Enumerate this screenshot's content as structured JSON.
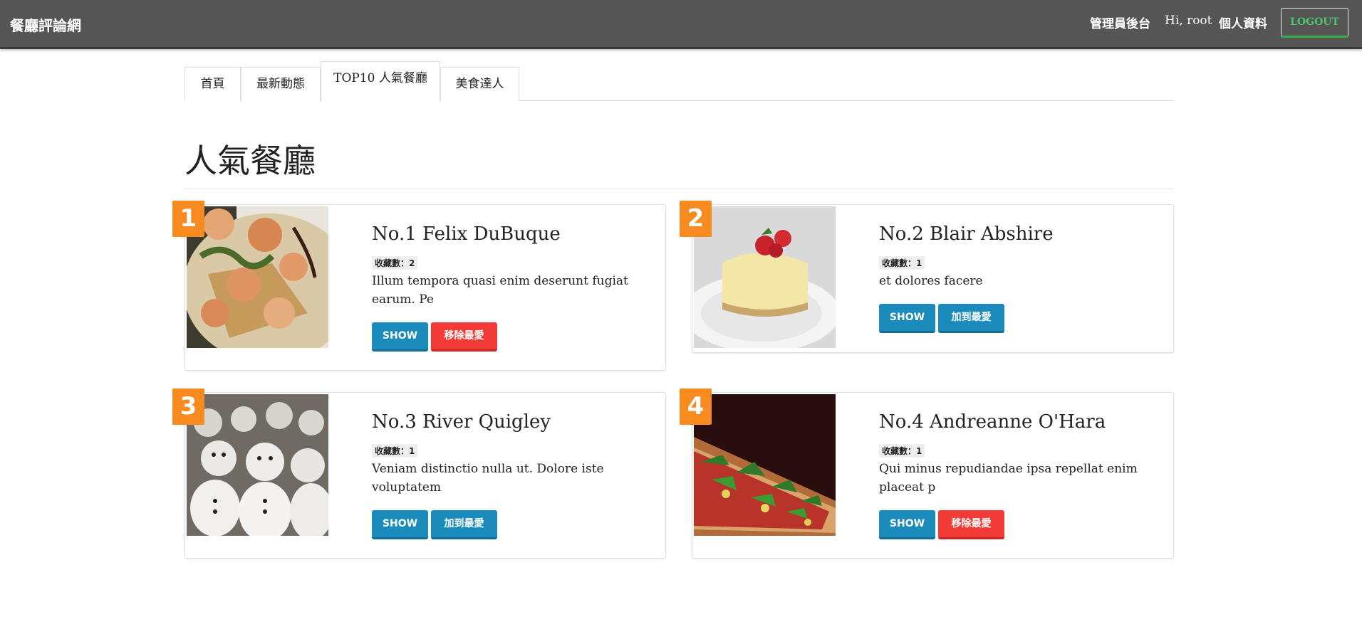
{
  "navbar": {
    "brand": "餐廳評論網",
    "admin_link": "管理員後台",
    "user_greeting": "Hi, root",
    "profile_link": "個人資料",
    "logout_label": "LOGOUT",
    "logout_color": "#49c76a"
  },
  "tabs": [
    {
      "label": "首頁",
      "active": false
    },
    {
      "label": "最新動態",
      "active": false
    },
    {
      "label": "TOP10 人氣餐廳",
      "active": true
    },
    {
      "label": "美食達人",
      "active": false
    }
  ],
  "page_title": "人氣餐廳",
  "restaurants": [
    {
      "rank": "1",
      "name": "No.1 Felix DuBuque",
      "fav_count": "收藏數：2",
      "description": "Illum tempora quasi enim deserunt fugiat earum. Pe",
      "show_label": "SHOW",
      "fav_button_label": "移除最愛",
      "image": "food-photo-shrimp-plate"
    },
    {
      "rank": "2",
      "name": "No.2 Blair Abshire",
      "fav_count": "收藏數：1",
      "description": "et dolores facere",
      "show_label": "SHOW",
      "fav_button_label": "加到最愛",
      "image": "food-photo-cheesecake"
    },
    {
      "rank": "3",
      "name": "No.3 River Quigley",
      "fav_count": "收藏數：1",
      "description": "Veniam distinctio nulla ut. Dolore iste voluptatem",
      "show_label": "SHOW",
      "fav_button_label": "加到最愛",
      "image": "food-photo-meringue-snowmen"
    },
    {
      "rank": "4",
      "name": "No.4 Andreanne O'Hara",
      "fav_count": "收藏數：1",
      "description": "Qui minus repudiandae ipsa repellat enim placeat p",
      "show_label": "SHOW",
      "fav_button_label": "移除最愛",
      "image": "food-photo-pizza"
    }
  ],
  "colors": {
    "navbar_bg": "#555555",
    "rank_badge": "#f78b1f",
    "primary_button": "#1b8bbc",
    "danger_button": "#f23b36"
  }
}
